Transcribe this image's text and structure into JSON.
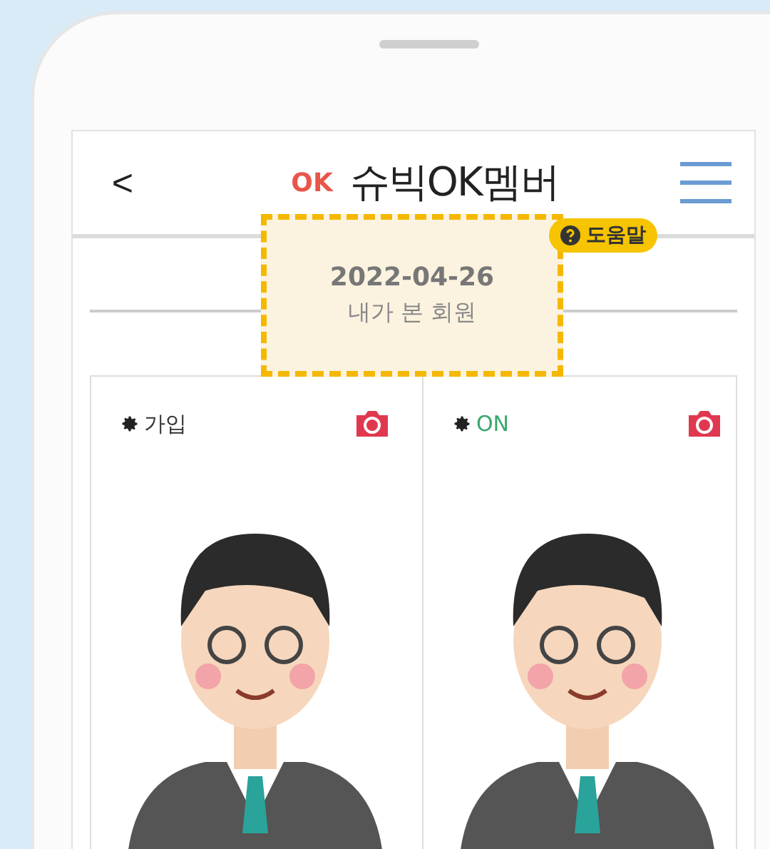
{
  "header": {
    "back": "<",
    "logo": "OK",
    "title": "슈빅OK멤버"
  },
  "help_badge": "도움말",
  "divider": {
    "date": "2022-04-26",
    "label": "내가 본 회원"
  },
  "members": [
    {
      "status": "가입",
      "color": "#333333"
    },
    {
      "status": "ON",
      "color": "#3aa76d"
    }
  ]
}
